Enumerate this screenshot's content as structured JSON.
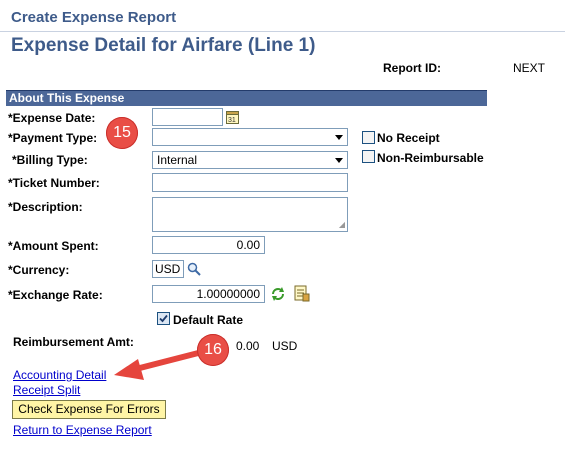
{
  "header": {
    "page_title": "Create Expense Report",
    "heading": "Expense Detail for Airfare (Line 1)",
    "report_id_label": "Report ID:",
    "report_id_value": "NEXT"
  },
  "section": {
    "title": "About This Expense"
  },
  "form": {
    "expense_date_label": "*Expense Date:",
    "expense_date_value": "",
    "payment_type_label": "*Payment Type:",
    "payment_type_value": "",
    "billing_type_label": "*Billing Type:",
    "billing_type_value": "Internal",
    "ticket_number_label": "*Ticket Number:",
    "ticket_number_value": "",
    "description_label": "*Description:",
    "description_value": "",
    "amount_spent_label": "*Amount Spent:",
    "amount_spent_value": "0.00",
    "currency_label": "*Currency:",
    "currency_value": "USD",
    "exchange_rate_label": "*Exchange Rate:",
    "exchange_rate_value": "1.00000000",
    "default_rate_label": "Default Rate",
    "no_receipt_label": "No Receipt",
    "non_reimbursable_label": "Non-Reimbursable",
    "reimbursement_label": "Reimbursement Amt:",
    "reimbursement_value": "0.00",
    "reimbursement_currency": "USD"
  },
  "links": {
    "accounting_detail": "Accounting Detail",
    "receipt_split": "Receipt Split",
    "check_button": "Check Expense For Errors",
    "return_link": "Return to Expense Report"
  },
  "annotations": {
    "badge_15": "15",
    "badge_16": "16"
  },
  "colors": {
    "title_blue": "#3e5b8a",
    "section_bg": "#4c6798",
    "badge_red": "#e94e46",
    "button_yellow": "#fff5a6"
  },
  "icons": [
    "calendar-icon",
    "search-icon",
    "refresh-icon",
    "exchange-rate-detail-icon"
  ]
}
